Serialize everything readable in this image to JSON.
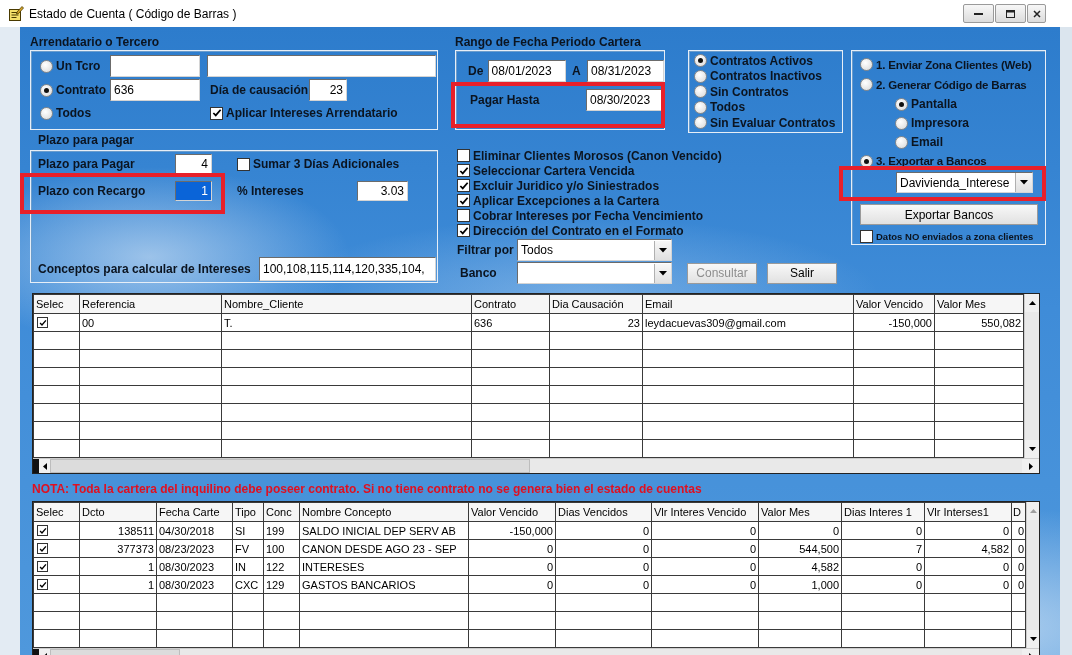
{
  "window": {
    "title": "Estado de Cuenta ( Código de Barras )"
  },
  "arrendatario": {
    "title": "Arrendatario o Tercero",
    "options": [
      {
        "label": "Un Tcro",
        "selected": false
      },
      {
        "label": "Contrato",
        "selected": true,
        "value": "636"
      },
      {
        "label": "Todos",
        "selected": false
      }
    ],
    "dia_causacion": {
      "label": "Día de causación",
      "value": "23"
    },
    "aplicar_intereses": {
      "label": "Aplicar Intereses Arrendatario",
      "checked": true
    }
  },
  "plazo": {
    "title": "Plazo para pagar",
    "plazo_pagar": {
      "label": "Plazo para Pagar",
      "value": "4"
    },
    "sumar_dias": {
      "label": "Sumar 3 Días Adicionales",
      "checked": false
    },
    "plazo_recargo": {
      "label": "Plazo con Recargo",
      "value": "1",
      "text_selected": true,
      "highlighted": true
    },
    "intereses": {
      "label": "% Intereses",
      "value": "3.03"
    },
    "conceptos": {
      "label": "Conceptos para calcular de Intereses",
      "value": "100,108,115,114,120,335,104,"
    }
  },
  "fechas": {
    "title": "Rango de Fecha Periodo Cartera",
    "de": {
      "label": "De",
      "value": "08/01/2023"
    },
    "a": {
      "label": "A",
      "value": "08/31/2023"
    },
    "pagar_hasta": {
      "label": "Pagar Hasta",
      "value": "08/30/2023",
      "highlighted": true
    }
  },
  "contratos": [
    {
      "label": "Contratos Activos",
      "selected": true
    },
    {
      "label": "Contratos Inactivos",
      "selected": false
    },
    {
      "label": "Sin Contratos",
      "selected": false
    },
    {
      "label": "Todos",
      "selected": false
    },
    {
      "label": "Sin Evaluar Contratos",
      "selected": false
    }
  ],
  "opciones": [
    {
      "label": "Eliminar Clientes Morosos (Canon Vencido)",
      "checked": false
    },
    {
      "label": "Seleccionar Cartera Vencida",
      "checked": true
    },
    {
      "label": "Excluir Juridico y/o Siniestrados",
      "checked": true
    },
    {
      "label": "Aplicar Excepciones a la Cartera",
      "checked": true
    },
    {
      "label": "Cobrar Intereses por Fecha Vencimiento",
      "checked": false
    },
    {
      "label": "Dirección del Contrato en el Formato",
      "checked": true
    }
  ],
  "filtrar": {
    "label": "Filtrar por",
    "value": "Todos"
  },
  "banco": {
    "label": "Banco"
  },
  "buttons": [
    {
      "label": "Consultar",
      "disabled": true
    },
    {
      "label": "Salir",
      "disabled": false
    }
  ],
  "envio": {
    "options": [
      {
        "label": "1. Enviar Zona Clientes (Web)",
        "selected": false
      },
      {
        "label": "2. Generar Código de Barras",
        "selected": false,
        "children": [
          {
            "label": "Pantalla",
            "selected": true
          },
          {
            "label": "Impresora",
            "selected": false
          },
          {
            "label": "Email",
            "selected": false
          }
        ]
      },
      {
        "label": "3. Exportar a Bancos",
        "selected": true
      }
    ],
    "banco_export": {
      "value": "Davivienda_Interese",
      "highlighted": true
    },
    "export_button": {
      "label": "Exportar Bancos"
    },
    "no_enviados": {
      "label": "Datos NO enviados a zona clientes",
      "checked": false
    }
  },
  "contracts_table": {
    "check_column": "Selec",
    "columns": [
      {
        "label": "Referencia",
        "kind": "text"
      },
      {
        "label": "Nombre_Cliente",
        "kind": "text"
      },
      {
        "label": "Contrato",
        "kind": "text"
      },
      {
        "label": "Dia Causación",
        "kind": "number"
      },
      {
        "label": "Email",
        "kind": "text"
      },
      {
        "label": "Valor Vencido",
        "kind": "number"
      },
      {
        "label": "Valor Mes",
        "kind": "number"
      }
    ],
    "rows": [
      {
        "checked": true,
        "cells": [
          "00",
          "T.",
          "636",
          "23",
          "leydacuevas309@gmail.com",
          "-150,000",
          "550,082"
        ]
      }
    ]
  },
  "note": "NOTA: Toda la cartera del inquilino debe poseer contrato. Si no tiene contrato no se genera bien el estado de cuentas",
  "concepts_table": {
    "check_column": "Selec",
    "columns": [
      {
        "label": "Dcto",
        "kind": "number"
      },
      {
        "label": "Fecha Carte",
        "kind": "text"
      },
      {
        "label": "Tipo",
        "kind": "text"
      },
      {
        "label": "Conc",
        "kind": "text"
      },
      {
        "label": "Nombre Concepto",
        "kind": "text"
      },
      {
        "label": "Valor Vencido",
        "kind": "number"
      },
      {
        "label": "Dias Vencidos",
        "kind": "number"
      },
      {
        "label": "Vlr Interes Vencido",
        "kind": "number"
      },
      {
        "label": "Valor Mes",
        "kind": "number"
      },
      {
        "label": "Dias Interes 1",
        "kind": "number"
      },
      {
        "label": "Vlr Interses1",
        "kind": "number"
      },
      {
        "label": "D",
        "kind": "number"
      }
    ],
    "rows": [
      {
        "checked": true,
        "cells": [
          "138511",
          "04/30/2018",
          "SI",
          "199",
          "SALDO INICIAL DEP SERV AB",
          "-150,000",
          "0",
          "0",
          "0",
          "0",
          "0",
          "0"
        ]
      },
      {
        "checked": true,
        "cells": [
          "377373",
          "08/23/2023",
          "FV",
          "100",
          "CANON DESDE AGO 23 - SEP",
          "0",
          "0",
          "0",
          "544,500",
          "7",
          "4,582",
          "0"
        ]
      },
      {
        "checked": true,
        "cells": [
          "1",
          "08/30/2023",
          "IN",
          "122",
          "INTERESES",
          "0",
          "0",
          "0",
          "4,582",
          "0",
          "0",
          "0"
        ]
      },
      {
        "checked": true,
        "cells": [
          "1",
          "08/30/2023",
          "CXC",
          "129",
          "GASTOS BANCARIOS",
          "0",
          "0",
          "0",
          "1,000",
          "0",
          "0",
          "0"
        ]
      }
    ]
  }
}
